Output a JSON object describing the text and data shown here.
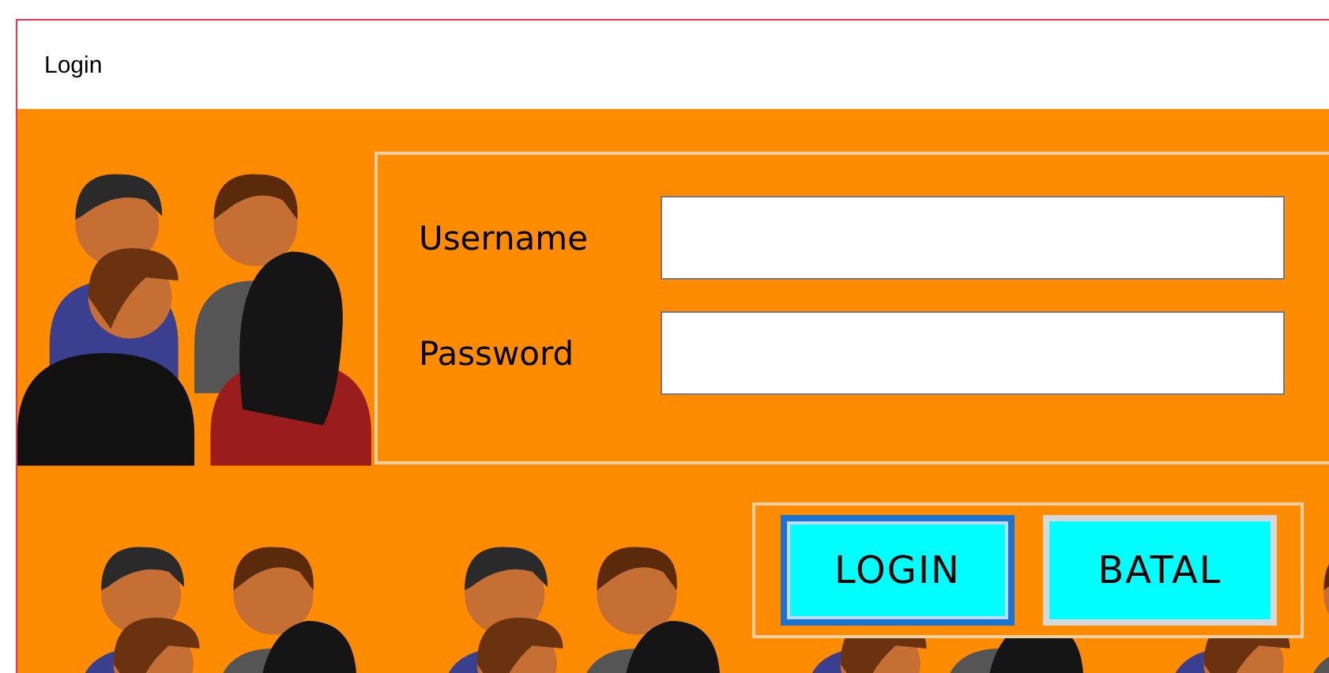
{
  "window": {
    "title": "Login"
  },
  "form": {
    "fields": [
      {
        "label": "Username"
      },
      {
        "label": "Password"
      }
    ]
  },
  "buttons": [
    {
      "label": "LOGIN",
      "focused": true
    },
    {
      "label": "BATAL",
      "focused": false
    }
  ]
}
